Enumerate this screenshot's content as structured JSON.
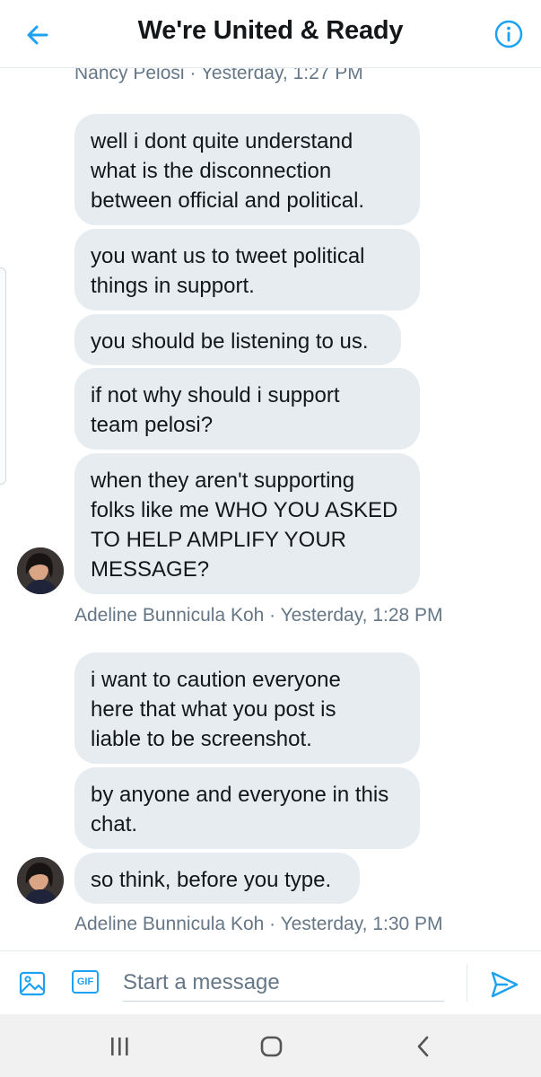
{
  "header": {
    "title": "We're United & Ready"
  },
  "conversation": {
    "top_meta": "Nancy Pelosi · Yesterday, 1:27 PM",
    "group1": {
      "messages": [
        "well i dont quite understand\nwhat is the disconnection\nbetween official and political.",
        "you want us to tweet political\nthings in support.",
        "you should be listening to us.",
        "if not why should i support\nteam pelosi?",
        "when they aren't supporting\nfolks like me WHO YOU ASKED\nTO HELP AMPLIFY YOUR\nMESSAGE?"
      ],
      "meta": "Adeline Bunnicula Koh · Yesterday, 1:28 PM"
    },
    "group2": {
      "messages": [
        "i want to caution everyone\nhere that what you post is\nliable to be screenshot.",
        "by anyone and everyone in this\nchat.",
        "so think, before you type."
      ],
      "meta": "Adeline Bunnicula Koh · Yesterday, 1:30 PM"
    }
  },
  "composer": {
    "gif_label": "GIF",
    "placeholder": "Start a message"
  },
  "colors": {
    "accent": "#1da1f2",
    "bubble": "#e6ecf0",
    "meta_text": "#657786"
  }
}
